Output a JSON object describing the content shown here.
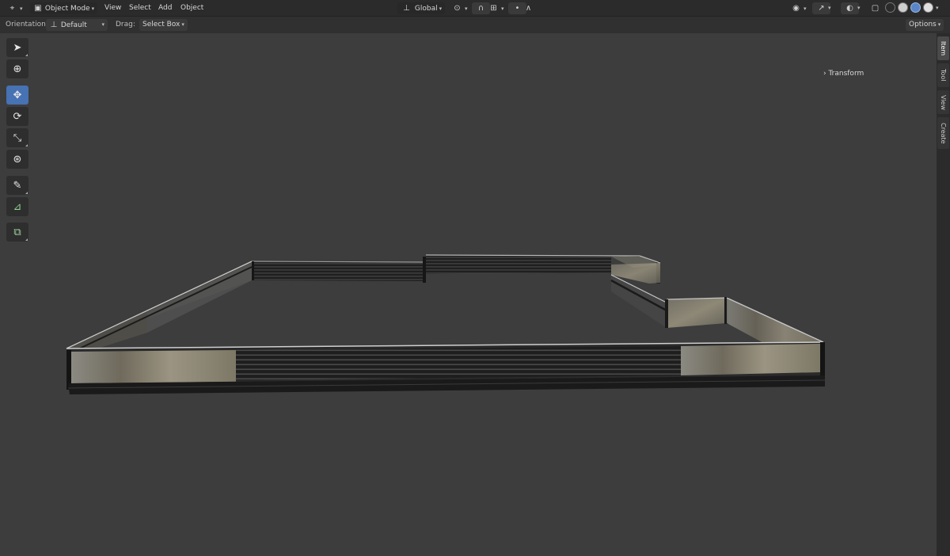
{
  "header": {
    "editor_icon": "3d-viewport-icon",
    "mode": "Object Mode",
    "menus": [
      "View",
      "Select",
      "Add",
      "Object"
    ],
    "transform_orientation": "Global"
  },
  "toolbar_settings": {
    "orientation_label": "Orientation:",
    "orientation_value": "Default",
    "drag_label": "Drag:",
    "drag_value": "Select Box",
    "options_label": "Options"
  },
  "sidebar": {
    "panel_title": "Transform",
    "tabs": [
      "Item",
      "Tool",
      "View",
      "Create"
    ],
    "active_tab": "Item"
  },
  "tools": [
    {
      "name": "select-box",
      "icon": "cursor-arrow-icon",
      "active": false
    },
    {
      "name": "cursor",
      "icon": "3d-cursor-icon",
      "active": false
    },
    {
      "name": "move",
      "icon": "move-arrows-icon",
      "active": true
    },
    {
      "name": "rotate",
      "icon": "rotate-icon",
      "active": false
    },
    {
      "name": "scale",
      "icon": "scale-icon",
      "active": false
    },
    {
      "name": "transform",
      "icon": "transform-icon",
      "active": false
    },
    {
      "name": "annotate",
      "icon": "annotate-pencil-icon",
      "active": false
    },
    {
      "name": "measure",
      "icon": "measure-ruler-icon",
      "active": false
    },
    {
      "name": "add-cube",
      "icon": "add-cube-icon",
      "active": false
    }
  ],
  "colors": {
    "viewport_bg": "#3d3d3d",
    "header_bg": "#2b2b2b",
    "accent": "#4772b3"
  }
}
